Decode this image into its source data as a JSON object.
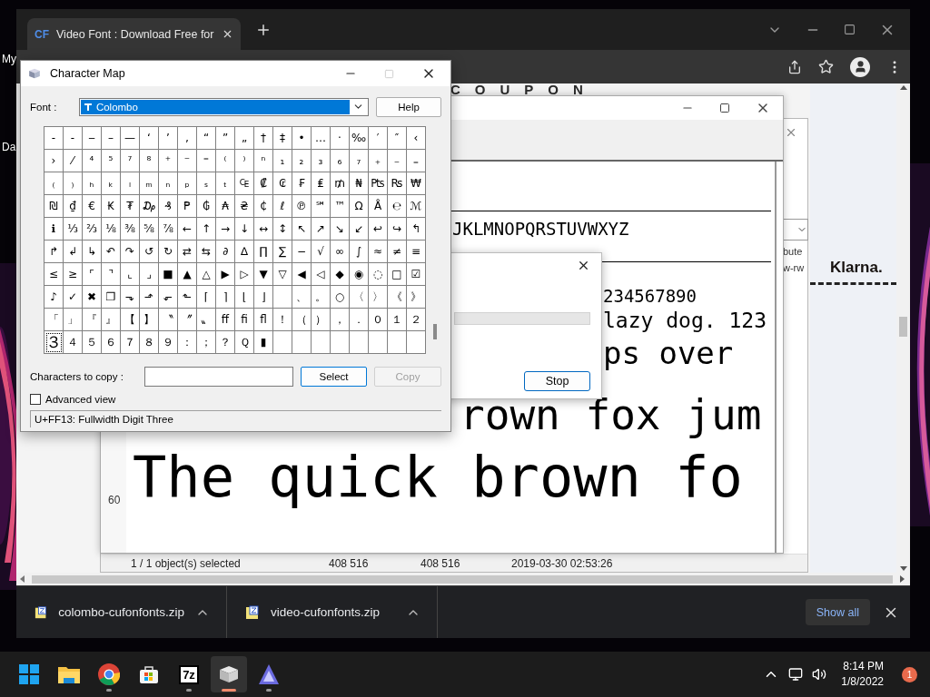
{
  "desktop": {
    "icon_labels": [
      "My",
      "Da"
    ]
  },
  "browser": {
    "tab": {
      "favicon": "CF",
      "title": "Video Font : Download Free for"
    },
    "page": {
      "heading": "COUPON",
      "logo": "Klarna.",
      "side_texts": [
        "bute",
        "w-rw"
      ]
    },
    "downloads": [
      {
        "name": "colombo-cufonfonts.zip"
      },
      {
        "name": "video-cufonfonts.zip"
      }
    ],
    "show_all": "Show all"
  },
  "file_window": {
    "status": [
      "1 / 1 object(s) selected",
      "408 516",
      "408 516",
      "2019-03-30 02:53:26"
    ]
  },
  "font_viewer": {
    "size_label": "60",
    "samples": [
      "JKLMNOPQRSTUVWXYZ",
      "234567890",
      "lazy dog. 123",
      "ps over",
      "rown fox jum",
      "The quick brown fo"
    ]
  },
  "progress_dialog": {
    "level": 0,
    "button": "Stop"
  },
  "character_map": {
    "title": "Character Map",
    "font_label": "Font :",
    "font": "Colombo",
    "help": "Help",
    "rows": [
      [
        {
          "c": "‐",
          "selected": false
        },
        {
          "c": "‑",
          "selected": false
        },
        {
          "c": "‒",
          "selected": false
        },
        {
          "c": "–",
          "selected": false
        },
        {
          "c": "—",
          "selected": false
        },
        {
          "c": "‘",
          "selected": false
        },
        {
          "c": "’",
          "selected": false
        },
        {
          "c": "‚",
          "selected": false
        },
        {
          "c": "“",
          "selected": false
        },
        {
          "c": "”",
          "selected": false
        },
        {
          "c": "„",
          "selected": false
        },
        {
          "c": "†",
          "selected": false
        },
        {
          "c": "‡",
          "selected": false
        },
        {
          "c": "•",
          "selected": false
        },
        {
          "c": "…",
          "selected": false
        },
        {
          "c": "‧",
          "selected": false
        },
        {
          "c": "‰",
          "selected": false
        },
        {
          "c": "′",
          "selected": false
        },
        {
          "c": "″",
          "selected": false
        },
        {
          "c": "‹",
          "selected": false
        }
      ],
      [
        {
          "c": "›",
          "selected": false
        },
        {
          "c": "⁄",
          "selected": false
        },
        {
          "c": "⁴",
          "selected": false
        },
        {
          "c": "⁵",
          "selected": false
        },
        {
          "c": "⁷",
          "selected": false
        },
        {
          "c": "⁸",
          "selected": false
        },
        {
          "c": "⁺",
          "selected": false
        },
        {
          "c": "⁻",
          "selected": false
        },
        {
          "c": "⁼",
          "selected": false
        },
        {
          "c": "⁽",
          "selected": false
        },
        {
          "c": "⁾",
          "selected": false
        },
        {
          "c": "ⁿ",
          "selected": false
        },
        {
          "c": "₁",
          "selected": false
        },
        {
          "c": "₂",
          "selected": false
        },
        {
          "c": "₃",
          "selected": false
        },
        {
          "c": "₆",
          "selected": false
        },
        {
          "c": "₇",
          "selected": false
        },
        {
          "c": "₊",
          "selected": false
        },
        {
          "c": "₋",
          "selected": false
        },
        {
          "c": "₌",
          "selected": false
        }
      ],
      [
        {
          "c": "₍",
          "selected": false
        },
        {
          "c": "₎",
          "selected": false
        },
        {
          "c": "ₕ",
          "selected": false
        },
        {
          "c": "ₖ",
          "selected": false
        },
        {
          "c": "ₗ",
          "selected": false
        },
        {
          "c": "ₘ",
          "selected": false
        },
        {
          "c": "ₙ",
          "selected": false
        },
        {
          "c": "ₚ",
          "selected": false
        },
        {
          "c": "ₛ",
          "selected": false
        },
        {
          "c": "ₜ",
          "selected": false
        },
        {
          "c": "₠",
          "selected": false
        },
        {
          "c": "₡",
          "selected": false
        },
        {
          "c": "₢",
          "selected": false
        },
        {
          "c": "₣",
          "selected": false
        },
        {
          "c": "₤",
          "selected": false
        },
        {
          "c": "₥",
          "selected": false
        },
        {
          "c": "₦",
          "selected": false
        },
        {
          "c": "₧",
          "selected": false
        },
        {
          "c": "₨",
          "selected": false
        },
        {
          "c": "₩",
          "selected": false
        }
      ],
      [
        {
          "c": "₪",
          "selected": false
        },
        {
          "c": "₫",
          "selected": false
        },
        {
          "c": "€",
          "selected": false
        },
        {
          "c": "₭",
          "selected": false
        },
        {
          "c": "₮",
          "selected": false
        },
        {
          "c": "₯",
          "selected": false
        },
        {
          "c": "₰",
          "selected": false
        },
        {
          "c": "₱",
          "selected": false
        },
        {
          "c": "₲",
          "selected": false
        },
        {
          "c": "₳",
          "selected": false
        },
        {
          "c": "₴",
          "selected": false
        },
        {
          "c": "₵",
          "selected": false
        },
        {
          "c": "ℓ",
          "selected": false
        },
        {
          "c": "℗",
          "selected": false
        },
        {
          "c": "℠",
          "selected": false
        },
        {
          "c": "™",
          "selected": false
        },
        {
          "c": "Ω",
          "selected": false
        },
        {
          "c": "Å",
          "selected": false
        },
        {
          "c": "℮",
          "selected": false
        },
        {
          "c": "ℳ",
          "selected": false
        }
      ],
      [
        {
          "c": "ℹ",
          "selected": false
        },
        {
          "c": "⅓",
          "selected": false
        },
        {
          "c": "⅔",
          "selected": false
        },
        {
          "c": "⅛",
          "selected": false
        },
        {
          "c": "⅜",
          "selected": false
        },
        {
          "c": "⅝",
          "selected": false
        },
        {
          "c": "⅞",
          "selected": false
        },
        {
          "c": "←",
          "selected": false
        },
        {
          "c": "↑",
          "selected": false
        },
        {
          "c": "→",
          "selected": false
        },
        {
          "c": "↓",
          "selected": false
        },
        {
          "c": "↔",
          "selected": false
        },
        {
          "c": "↕",
          "selected": false
        },
        {
          "c": "↖",
          "selected": false
        },
        {
          "c": "↗",
          "selected": false
        },
        {
          "c": "↘",
          "selected": false
        },
        {
          "c": "↙",
          "selected": false
        },
        {
          "c": "↩",
          "selected": false
        },
        {
          "c": "↪",
          "selected": false
        },
        {
          "c": "↰",
          "selected": false
        }
      ],
      [
        {
          "c": "↱",
          "selected": false
        },
        {
          "c": "↲",
          "selected": false
        },
        {
          "c": "↳",
          "selected": false
        },
        {
          "c": "↶",
          "selected": false
        },
        {
          "c": "↷",
          "selected": false
        },
        {
          "c": "↺",
          "selected": false
        },
        {
          "c": "↻",
          "selected": false
        },
        {
          "c": "⇄",
          "selected": false
        },
        {
          "c": "⇆",
          "selected": false
        },
        {
          "c": "∂",
          "selected": false
        },
        {
          "c": "∆",
          "selected": false
        },
        {
          "c": "∏",
          "selected": false
        },
        {
          "c": "∑",
          "selected": false
        },
        {
          "c": "−",
          "selected": false
        },
        {
          "c": "√",
          "selected": false
        },
        {
          "c": "∞",
          "selected": false
        },
        {
          "c": "∫",
          "selected": false
        },
        {
          "c": "≈",
          "selected": false
        },
        {
          "c": "≠",
          "selected": false
        },
        {
          "c": "≡",
          "selected": false
        }
      ],
      [
        {
          "c": "≤",
          "selected": false
        },
        {
          "c": "≥",
          "selected": false
        },
        {
          "c": "⌜",
          "selected": false
        },
        {
          "c": "⌝",
          "selected": false
        },
        {
          "c": "⌞",
          "selected": false
        },
        {
          "c": "⌟",
          "selected": false
        },
        {
          "c": "■",
          "selected": false
        },
        {
          "c": "▲",
          "selected": false
        },
        {
          "c": "△",
          "selected": false
        },
        {
          "c": "▶",
          "selected": false
        },
        {
          "c": "▷",
          "selected": false
        },
        {
          "c": "▼",
          "selected": false
        },
        {
          "c": "▽",
          "selected": false
        },
        {
          "c": "◀",
          "selected": false
        },
        {
          "c": "◁",
          "selected": false
        },
        {
          "c": "◆",
          "selected": false
        },
        {
          "c": "◉",
          "selected": false
        },
        {
          "c": "◌",
          "selected": false
        },
        {
          "c": "□",
          "selected": false
        },
        {
          "c": "☑",
          "selected": false
        }
      ],
      [
        {
          "c": "♪",
          "selected": false
        },
        {
          "c": "✓",
          "selected": false
        },
        {
          "c": "✖",
          "selected": false
        },
        {
          "c": "❐",
          "selected": false
        },
        {
          "c": "⬎",
          "selected": false
        },
        {
          "c": "⬏",
          "selected": false
        },
        {
          "c": "⬐",
          "selected": false
        },
        {
          "c": "⬑",
          "selected": false
        },
        {
          "c": "⌈",
          "selected": false
        },
        {
          "c": "⌉",
          "selected": false
        },
        {
          "c": "⌊",
          "selected": false
        },
        {
          "c": "⌋",
          "selected": false
        },
        {
          "selected": false
        },
        {
          "c": "、",
          "selected": false
        },
        {
          "c": "。",
          "selected": false
        },
        {
          "c": "○",
          "selected": false
        },
        {
          "c": "〈",
          "selected": false
        },
        {
          "c": "〉",
          "selected": false
        },
        {
          "c": "《",
          "selected": false
        },
        {
          "c": "》",
          "selected": false
        }
      ],
      [
        {
          "c": "「",
          "selected": false
        },
        {
          "c": "」",
          "selected": false
        },
        {
          "c": "『",
          "selected": false
        },
        {
          "c": "』",
          "selected": false
        },
        {
          "c": "【",
          "selected": false
        },
        {
          "c": "】",
          "selected": false
        },
        {
          "c": "〝",
          "selected": false
        },
        {
          "c": "〞",
          "selected": false
        },
        {
          "c": "〟",
          "selected": false
        },
        {
          "c": "ﬀ",
          "selected": false
        },
        {
          "c": "ﬁ",
          "selected": false
        },
        {
          "c": "ﬂ",
          "selected": false
        },
        {
          "c": "！",
          "selected": false
        },
        {
          "c": "（",
          "selected": false
        },
        {
          "c": "）",
          "selected": false
        },
        {
          "c": "，",
          "selected": false
        },
        {
          "c": "．",
          "selected": false
        },
        {
          "c": "０",
          "selected": false
        },
        {
          "c": "１",
          "selected": false
        },
        {
          "c": "２",
          "selected": false
        }
      ],
      [
        {
          "c": "３",
          "selected": true
        },
        {
          "c": "４",
          "selected": false
        },
        {
          "c": "５",
          "selected": false
        },
        {
          "c": "６",
          "selected": false
        },
        {
          "c": "７",
          "selected": false
        },
        {
          "c": "８",
          "selected": false
        },
        {
          "c": "９",
          "selected": false
        },
        {
          "c": "：",
          "selected": false
        },
        {
          "c": "；",
          "selected": false
        },
        {
          "c": "？",
          "selected": false
        },
        {
          "c": "Ｑ",
          "selected": false
        },
        {
          "c": "▮",
          "selected": false
        }
      ]
    ],
    "copy_label": "Characters to copy :",
    "select": "Select",
    "copy": {
      "label": "Copy",
      "disabled": true
    },
    "advanced": {
      "label": "Advanced view",
      "checked": false
    },
    "status": "U+FF13: Fullwidth Digit Three"
  },
  "taskbar": {
    "apps": [
      {
        "kind": "start",
        "running": false,
        "selected": false
      },
      {
        "kind": "explorer",
        "running": false,
        "selected": false
      },
      {
        "kind": "chrome",
        "running": true,
        "selected": false
      },
      {
        "kind": "store",
        "running": false,
        "selected": false
      },
      {
        "kind": "archiver",
        "label": "7z",
        "running": true,
        "selected": false
      },
      {
        "kind": "charmap",
        "running": true,
        "selected": true
      },
      {
        "kind": "editor",
        "running": true,
        "selected": false
      }
    ],
    "time": "8:14 PM",
    "date": "1/8/2022",
    "notifications": "1"
  }
}
